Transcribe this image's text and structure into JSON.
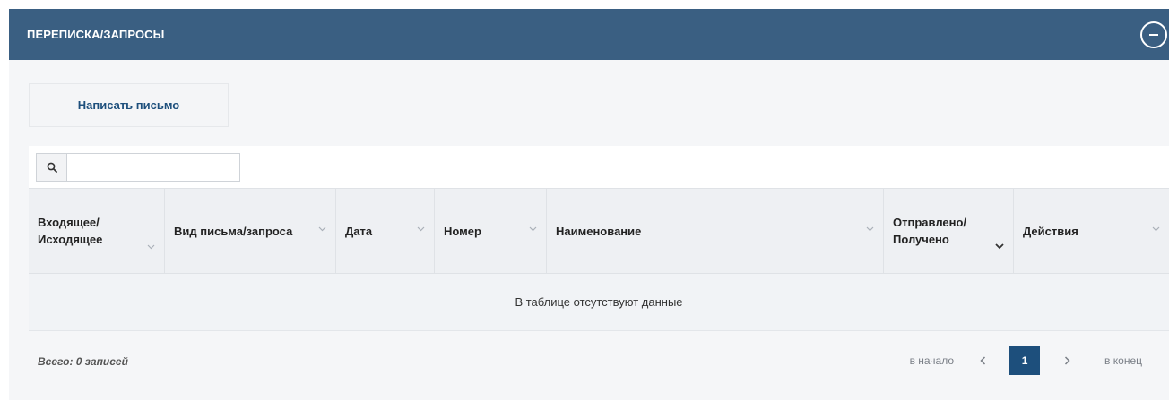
{
  "panel": {
    "title": "ПЕРЕПИСКА/ЗАПРОСЫ"
  },
  "toolbar": {
    "write_label": "Написать письмо"
  },
  "search": {
    "value": "",
    "placeholder": ""
  },
  "table": {
    "columns": [
      {
        "label": "Входящее/ Исходящее"
      },
      {
        "label": "Вид письма/запроса"
      },
      {
        "label": "Дата"
      },
      {
        "label": "Номер"
      },
      {
        "label": "Наименование"
      },
      {
        "label": "Отправлено/ Получено"
      },
      {
        "label": "Действия"
      }
    ],
    "empty_message": "В таблице отсутствуют данные"
  },
  "footer": {
    "total": "Всего: 0 записей"
  },
  "pagination": {
    "first": "в начало",
    "current": "1",
    "last": "в конец"
  },
  "colors": {
    "header_bg": "#3a5f82",
    "accent": "#1d4f7c"
  },
  "icons": {
    "collapse": "minus-circle-icon",
    "search": "search-icon",
    "sort": "chevron-down-icon",
    "prev": "chevron-left-icon",
    "next": "chevron-right-icon"
  }
}
